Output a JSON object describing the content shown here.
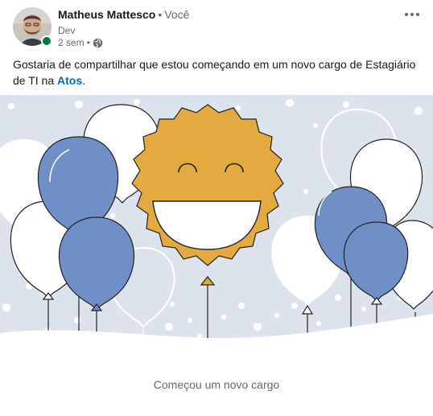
{
  "author": {
    "name": "Matheus Mattesco",
    "relation": "Você",
    "headline": "Dev",
    "time": "2 sem",
    "visibility_icon": "globe-icon"
  },
  "post": {
    "text_before": "Gostaria de compartilhar que estou começando em um novo cargo de Estagiário de TI na ",
    "company": "Atos",
    "text_after": "."
  },
  "banner": {
    "caption": "Começou um novo cargo"
  },
  "colors": {
    "accent_blue": "#6F8FC6",
    "sun_gold": "#E2AA3F",
    "background": "#DDE3EC",
    "link": "#0A66C2",
    "online": "#057642"
  }
}
